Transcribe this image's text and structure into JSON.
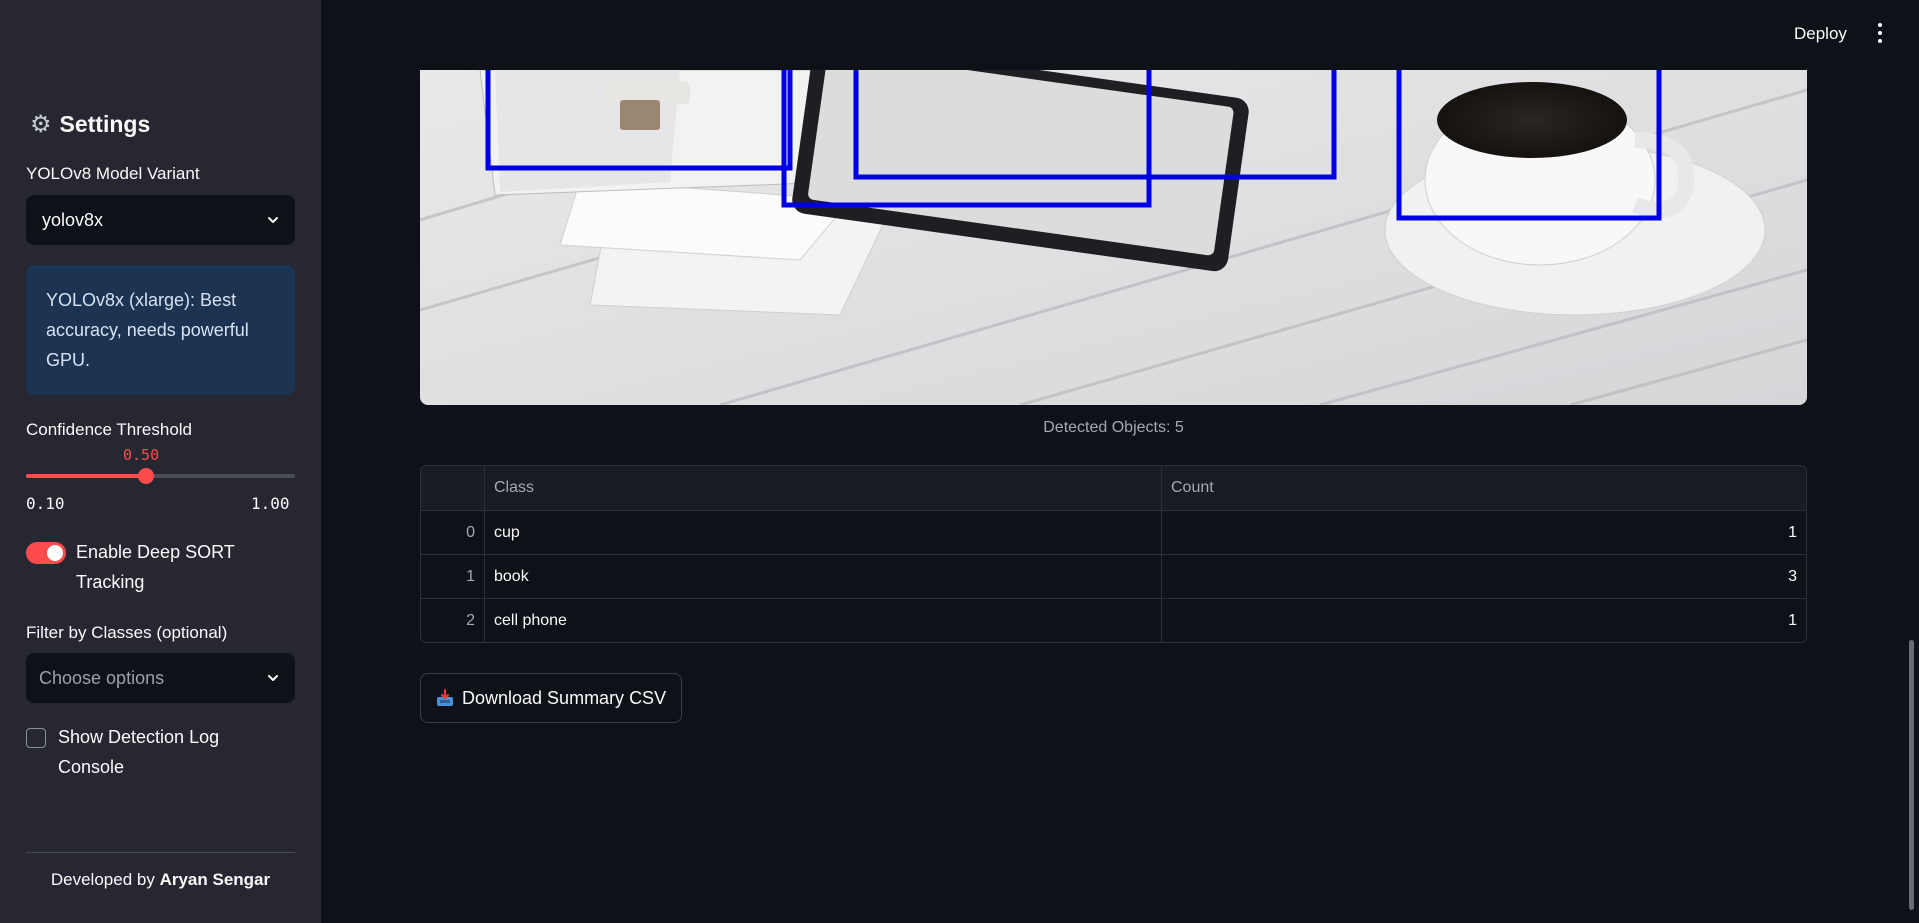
{
  "sidebar": {
    "title": "Settings",
    "title_icon": "gear-icon",
    "model_variant": {
      "label": "YOLOv8 Model Variant",
      "selected": "yolov8x"
    },
    "model_info": "YOLOv8x (xlarge): Best accuracy, needs powerful GPU.",
    "confidence": {
      "label": "Confidence Threshold",
      "value": 0.5,
      "value_text": "0.50",
      "min": 0.1,
      "min_text": "0.10",
      "max": 1.0,
      "max_text": "1.00"
    },
    "tracking_toggle": {
      "label": "Enable Deep SORT Tracking",
      "checked": true
    },
    "class_filter": {
      "label": "Filter by Classes (optional)",
      "placeholder": "Choose options"
    },
    "log_checkbox": {
      "label": "Show Detection Log Console",
      "checked": false
    },
    "credit_prefix": "Developed by",
    "credit_name": "Aryan Sengar"
  },
  "header": {
    "deploy_label": "Deploy",
    "menu_icon": "kebab-menu-icon"
  },
  "main": {
    "image_alt": "Annotated detection image with bounding boxes around books, tablet and cup",
    "caption": "Detected Objects: 5",
    "table": {
      "columns": [
        "",
        "Class",
        "Count"
      ],
      "rows": [
        {
          "index": "0",
          "class": "cup",
          "count": "1"
        },
        {
          "index": "1",
          "class": "book",
          "count": "3"
        },
        {
          "index": "2",
          "class": "cell phone",
          "count": "1"
        }
      ]
    },
    "download_button": {
      "label": "Download Summary CSV",
      "icon": "inbox-tray-icon"
    }
  },
  "colors": {
    "accent": "#ff4b4b",
    "background": "#0e1117",
    "sidebar": "#262730",
    "info_box": "#1c3451",
    "bbox": "#0000e6"
  }
}
